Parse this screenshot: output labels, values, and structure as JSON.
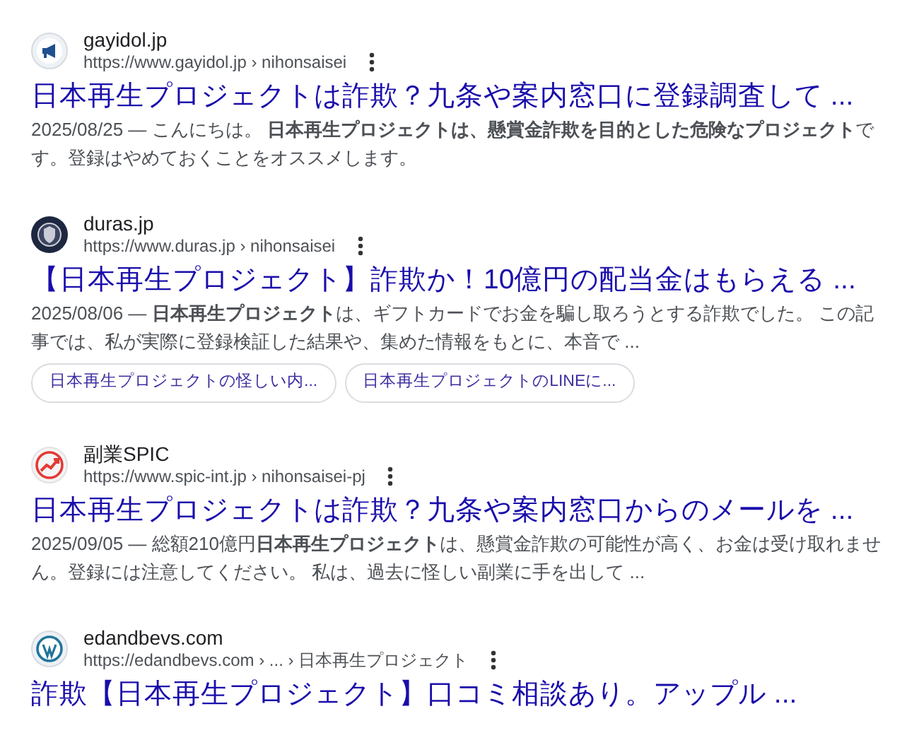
{
  "results": [
    {
      "site": "gayidol.jp",
      "url": "https://www.gayidol.jp › nihonsaisei",
      "title": "日本再生プロジェクトは詐欺？九条や案内窓口に登録調査して ...",
      "date": "2025/08/25 —",
      "snippet": "こんにちは。 **日本再生プロジェクトは、懸賞金詐欺を目的とした危険なプロジェクト**です。登録はやめておくことをオススメします。"
    },
    {
      "site": "duras.jp",
      "url": "https://www.duras.jp › nihonsaisei",
      "title": "【日本再生プロジェクト】詐欺か！10億円の配当金はもらえる ...",
      "date": "2025/08/06 —",
      "snippet": "**日本再生プロジェクト**は、ギフトカードでお金を騙し取ろうとする詐欺でした。 この記事では、私が実際に登録検証した結果や、集めた情報をもとに、本音で ...",
      "chips": [
        "日本再生プロジェクトの怪しい内...",
        "日本再生プロジェクトのLINEに..."
      ]
    },
    {
      "site": "副業SPIC",
      "url": "https://www.spic-int.jp › nihonsaisei-pj",
      "title": "日本再生プロジェクトは詐欺？九条や案内窓口からのメールを ...",
      "date": "2025/09/05 —",
      "snippet": "総額210億円**日本再生プロジェクト**は、懸賞金詐欺の可能性が高く、お金は受け取れません。登録には注意してください。 私は、過去に怪しい副業に手を出して ..."
    },
    {
      "site": "edandbevs.com",
      "url": "https://edandbevs.com › ... › 日本再生プロジェクト",
      "title": "詐欺【日本再生プロジェクト】口コミ相談あり。アップル ..."
    }
  ]
}
